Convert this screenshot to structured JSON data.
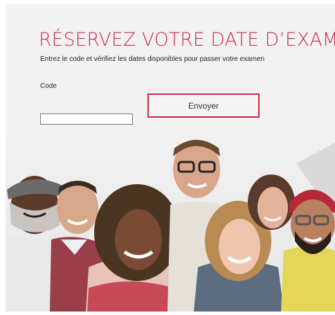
{
  "header": {
    "title": "RÉSERVEZ VOTRE DATE D’EXAMEN",
    "subtitle": "Entrez le code et vérifiez les dates disponibles pour passer votre examen"
  },
  "form": {
    "code_label": "Code",
    "code_value": "",
    "submit_label": "Envoyer"
  },
  "colors": {
    "accent": "#d02a48",
    "button_border": "#c8283f"
  },
  "images": {
    "hero": "group-of-smiling-people-photo"
  }
}
